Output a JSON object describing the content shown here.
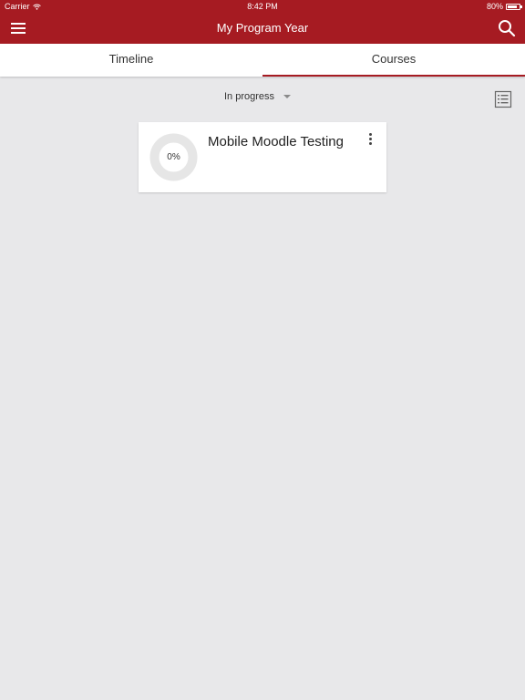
{
  "status_bar": {
    "carrier": "Carrier",
    "time": "8:42 PM",
    "battery": "80%",
    "battery_level": 0.8
  },
  "app_bar": {
    "title": "My Program Year",
    "menu_icon": "hamburger-menu-icon",
    "search_icon": "search-icon"
  },
  "tabs": [
    {
      "label": "Timeline",
      "active": false
    },
    {
      "label": "Courses",
      "active": true
    }
  ],
  "filter": {
    "selected": "In progress",
    "view_toggle_icon": "list-view-icon"
  },
  "courses": [
    {
      "name": "Mobile Moodle Testing",
      "progress_label": "0%",
      "progress": 0,
      "menu_icon": "more-vertical-icon"
    }
  ],
  "colors": {
    "brand": "#a61b22",
    "background": "#e8e8ea",
    "card": "#ffffff"
  }
}
